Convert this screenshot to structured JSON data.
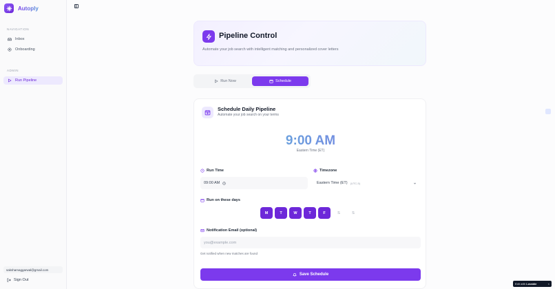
{
  "app": {
    "name": "Autoply"
  },
  "sidebar": {
    "nav_section": "NAVIGATION",
    "items": [
      {
        "label": "Inbox"
      },
      {
        "label": "Onboarding"
      }
    ],
    "admin_section": "ADMIN",
    "admin_items": [
      {
        "label": "Run Pipeline"
      }
    ],
    "user_email": "sakshamaggarwal@gmail.com",
    "signout_label": "Sign Out"
  },
  "header": {
    "title": "Pipeline Control",
    "subtitle": "Automate your job search with intelligent matching and personalized cover letters"
  },
  "tabs": [
    {
      "label": "Run Now"
    },
    {
      "label": "Schedule"
    }
  ],
  "schedule": {
    "title": "Schedule Daily Pipeline",
    "subtitle": "Automate your job search on your terms",
    "time_display": "9:00 AM",
    "timezone_display": "Eastern Time (ET)",
    "run_time_label": "Run Time",
    "run_time_value": "09:00 AM",
    "timezone_label": "Timezone",
    "timezone_value": "Eastern Time (ET)",
    "timezone_offset": "(UTC-5)",
    "days_label": "Run on these days",
    "days": [
      "M",
      "T",
      "W",
      "T",
      "F",
      "S",
      "S"
    ],
    "email_label": "Notification Email (optional)",
    "email_placeholder": "you@example.com",
    "email_hint": "Get notified when new matches are found",
    "save_label": "Save Schedule"
  },
  "badge": {
    "text": "Edit with",
    "brand": "Lovable",
    "close": "×"
  },
  "colors": {
    "accent": "#7c3aed",
    "accent_light": "#ede9fe"
  }
}
